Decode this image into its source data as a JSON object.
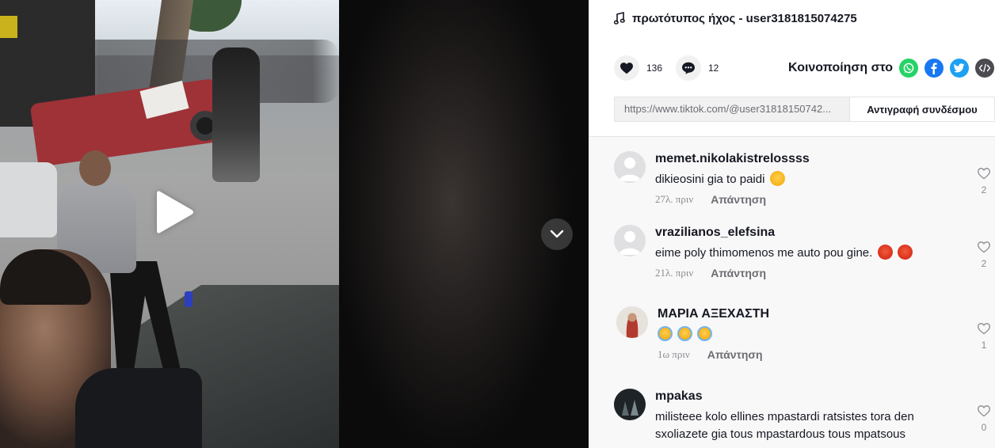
{
  "music": {
    "title": "πρωτότυπος ήχος - user3181815074275"
  },
  "stats": {
    "likes": "136",
    "comments": "12"
  },
  "share": {
    "label": "Κοινοποίηση στο"
  },
  "link": {
    "url": "https://www.tiktok.com/@user31818150742...",
    "copy_label": "Αντιγραφή συνδέσμου"
  },
  "colors": {
    "whatsapp": "#25D366",
    "facebook": "#1877F2",
    "twitter": "#1DA1F2",
    "embed": "#4b4b50"
  },
  "comments": [
    {
      "user": "memet.nikolakistrelossss",
      "text": "dikieosini gia to paidi",
      "emojis": [
        "sad"
      ],
      "time": "27λ. πριν",
      "reply": "Απάντηση",
      "likes": "2"
    },
    {
      "user": "vrazilianos_elefsina",
      "text": "eime poly thimomenos me auto pou gine.",
      "emojis": [
        "angry",
        "angry"
      ],
      "time": "21λ. πριν",
      "reply": "Απάντηση",
      "likes": "2"
    },
    {
      "user": "ΜΑΡΙΑ ΑΞΕΧΑΣΤΗ",
      "text": "",
      "emojis": [
        "cry",
        "cry",
        "cry"
      ],
      "time": "1ω πριν",
      "reply": "Απάντηση",
      "likes": "1"
    },
    {
      "user": "mpakas",
      "text": "milisteee kolo ellines mpastardi ratsistes tora den sxoliazete gia tous mpastardous tous mpatsous",
      "emojis": [],
      "time": "",
      "reply": "",
      "likes": "0"
    }
  ]
}
